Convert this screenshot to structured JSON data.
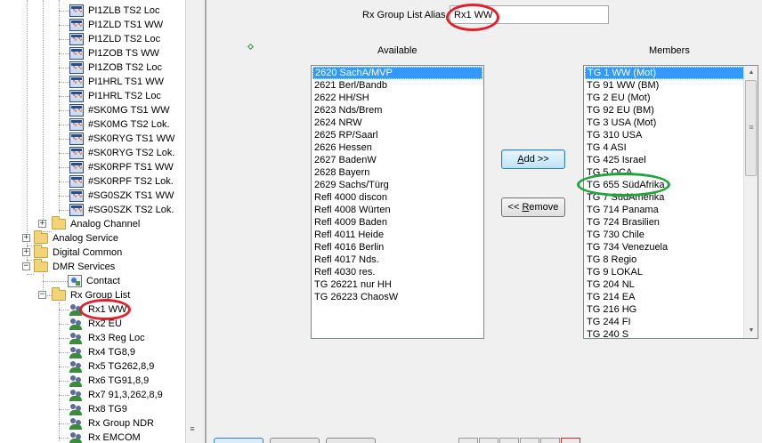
{
  "tree": {
    "channel_items": [
      "PI1ZLB TS2 Loc",
      "PI1ZLD TS1 WW",
      "PI1ZLD TS2 Loc",
      "PI1ZOB TS WW",
      "PI1ZOB TS2 Loc",
      "PI1HRL TS1 WW",
      "PI1HRL TS2 Loc",
      "#SK0MG TS1 WW",
      "#SK0MG TS2 Lok.",
      "#SK0RYG TS1 WW",
      "#SK0RYG TS2 Lok.",
      "#SK0RPF TS1 WW",
      "#SK0RPF TS2 Lok.",
      "#SG0SZK TS1 WW",
      "#SG0SZK TS2 Lok."
    ],
    "analog_channel": "Analog Channel",
    "analog_service": "Analog Service",
    "digital_common": "Digital Common",
    "dmr_services": "DMR Services",
    "contact": "Contact",
    "rx_group_list": "Rx Group List",
    "rx_groups": [
      "Rx1 WW",
      "Rx2 EU",
      "Rx3 Reg Loc",
      "Rx4 TG8,9",
      "Rx5 TG262,8,9",
      "Rx6 TG91,8,9",
      "Rx7 91,3,262,8,9",
      "Rx8 TG9",
      "Rx Group NDR",
      "Rx EMCOM"
    ],
    "expander_plus": "+",
    "expander_minus": "−"
  },
  "form": {
    "alias_label": "Rx Group List Alias",
    "alias_value": "Rx1 WW",
    "available_header": "Available",
    "members_header": "Members",
    "add_label": "Add >>",
    "remove_label": "<< Remove"
  },
  "available": [
    "2620 SachA/MVP",
    "2621 Berl/Bandb",
    "2622 HH/SH",
    "2623 Nds/Brem",
    "2624 NRW",
    "2625 RP/Saarl",
    "2626 Hessen",
    "2627 BadenW",
    "2628 Bayern",
    "2629 Sachs/Türg",
    "Refl 4000 discon",
    "Refl 4008 Würten",
    "Refl 4009 Baden",
    "Refl 4011 Heide",
    "Refl 4016 Berlin",
    "Refl 4017 Nds.",
    "Refl 4030 res.",
    "TG 26221 nur HH",
    "TG 26223 ChaosW"
  ],
  "members": [
    "TG 1 WW (Mot)",
    "TG 91 WW (BM)",
    "TG 2 EU (Mot)",
    "TG 92 EU (BM)",
    "TG 3 USA (Mot)",
    "TG 310 USA",
    "TG 4 ASI",
    "TG 425 Israel",
    "TG 5 OCA",
    "TG 655 SüdAfrika",
    "TG 7 SüdAmerika",
    "TG 714 Panama",
    "TG 724 Brasilien",
    "TG 730 Chile",
    "TG 734 Venezuela",
    "TG 8 Regio",
    "TG 9 LOKAL",
    "TG 204 NL",
    "TG 214 EA",
    "TG 216 HG",
    "TG 244 FI",
    "TG 240 S"
  ],
  "scrollbar": {
    "up_arrow": "▲",
    "down_arrow": "▼",
    "grip": "≡"
  },
  "colors": {
    "selection": "#3399ff",
    "red_annotation": "#e0212b",
    "green_annotation": "#1fa33a"
  }
}
